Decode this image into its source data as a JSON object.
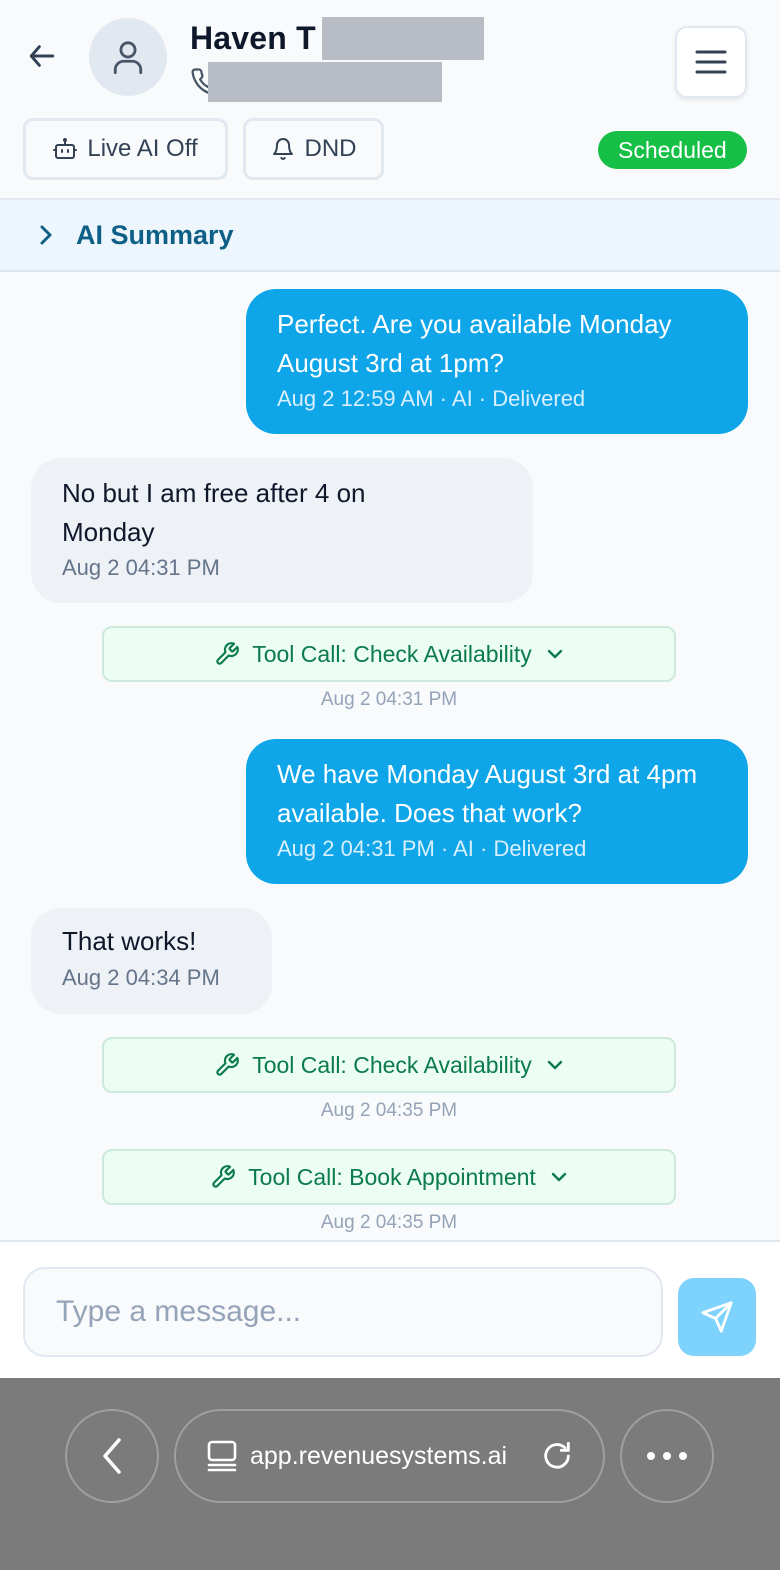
{
  "header": {
    "contact_name": "Haven T",
    "menu_icon": "hamburger-menu-icon",
    "live_ai_label": "Live AI Off",
    "dnd_label": "DND",
    "status": "Scheduled",
    "status_color": "#16c046"
  },
  "summary": {
    "label": "AI Summary"
  },
  "messages": [
    {
      "direction": "outgoing",
      "text": "Perfect. Are you available Monday August 3rd at 1pm?",
      "meta": "Aug 2 12:59 AM · AI · Delivered"
    },
    {
      "direction": "incoming",
      "text": "No but I am free after 4 on Monday",
      "meta": "Aug 2 04:31 PM"
    },
    {
      "type": "tool_call",
      "label": "Tool Call: Check Availability",
      "time": "Aug 2 04:31 PM"
    },
    {
      "direction": "outgoing",
      "text": "We have Monday August 3rd at 4pm available. Does that work?",
      "meta": "Aug 2 04:31 PM · AI · Delivered"
    },
    {
      "direction": "incoming",
      "text": "That works!",
      "meta": "Aug 2 04:34 PM"
    },
    {
      "type": "tool_call",
      "label": "Tool Call: Check Availability",
      "time": "Aug 2 04:35 PM"
    },
    {
      "type": "tool_call",
      "label": "Tool Call: Book Appointment",
      "time": "Aug 2 04:35 PM"
    }
  ],
  "composer": {
    "placeholder": "Type a message..."
  },
  "browser": {
    "url": "app.revenuesystems.ai"
  },
  "colors": {
    "outgoing_bubble": "#0ea5e9",
    "incoming_bubble": "#eef1f5",
    "tool_call_text": "#0b7a4d",
    "summary_text": "#0e5f86"
  }
}
